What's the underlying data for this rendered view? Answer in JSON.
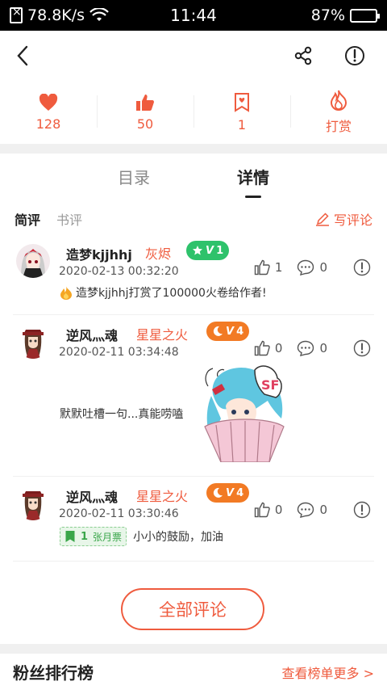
{
  "status": {
    "speed": "78.8K/s",
    "time": "11:44",
    "battery": "87%",
    "battery_level": 0.87
  },
  "nav": {
    "back_icon": "chevron-left-icon",
    "share_icon": "share-icon",
    "report_icon": "alert-icon"
  },
  "stats": [
    {
      "icon": "heart-icon",
      "value": "128"
    },
    {
      "icon": "thumbs-up-icon",
      "value": "50"
    },
    {
      "icon": "ticket-icon",
      "value": "1"
    },
    {
      "icon": "flame-icon",
      "value": "打赏"
    }
  ],
  "tabs": [
    {
      "label": "目录"
    },
    {
      "label": "详情"
    }
  ],
  "subtabs": [
    {
      "label": "简评"
    },
    {
      "label": "书评"
    }
  ],
  "write_comment": "写评论",
  "comments": [
    {
      "user": "造梦kjjhhj",
      "title": "灰烬",
      "badge_level": "1",
      "date": "2020-02-13 00:32:20",
      "likes": "1",
      "replies": "0",
      "text": "造梦kjjhhj打赏了100000火卷给作者!"
    },
    {
      "user": "逆风灬魂",
      "title": "星星之火",
      "badge_level": "4",
      "date": "2020-02-11 03:34:48",
      "likes": "0",
      "replies": "0",
      "text": "默默吐槽一句...真能唠嗑"
    },
    {
      "user": "逆风灬魂",
      "title": "星星之火",
      "badge_level": "4",
      "date": "2020-02-11 03:30:46",
      "likes": "0",
      "replies": "0",
      "ticket_count": "1",
      "ticket_label": "张月票",
      "text": "小小的鼓励，加油"
    }
  ],
  "all_comments": "全部评论",
  "fans": {
    "title": "粉丝排行榜",
    "more": "查看榜单更多 >"
  },
  "colors": {
    "accent": "#ef5b3e",
    "badge_green": "#2ec26b",
    "badge_orange": "#f27a24"
  }
}
